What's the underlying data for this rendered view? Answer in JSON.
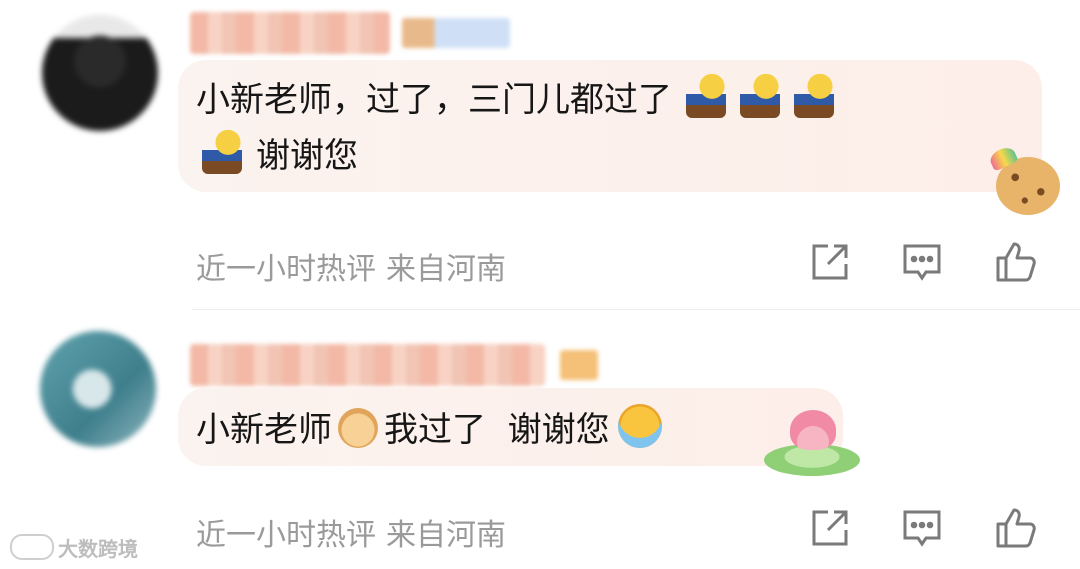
{
  "comments": [
    {
      "text_main": "小新老师，过了，三门儿都过了",
      "text_tail": "谢谢您",
      "time": "近一小时热评",
      "location": "来自河南"
    },
    {
      "text_part1": "小新老师",
      "text_part2": "我过了  谢谢您",
      "time": "近一小时热评",
      "location": "来自河南"
    }
  ],
  "icons": {
    "share": "share-icon",
    "reply": "comment-icon",
    "like": "thumbs-up-icon"
  },
  "watermark": {
    "text": "大数跨境"
  },
  "colors": {
    "bubble_bg": "#fbf3ef",
    "meta_text": "#9a9a9a",
    "icon_stroke": "#7a7a7a"
  }
}
